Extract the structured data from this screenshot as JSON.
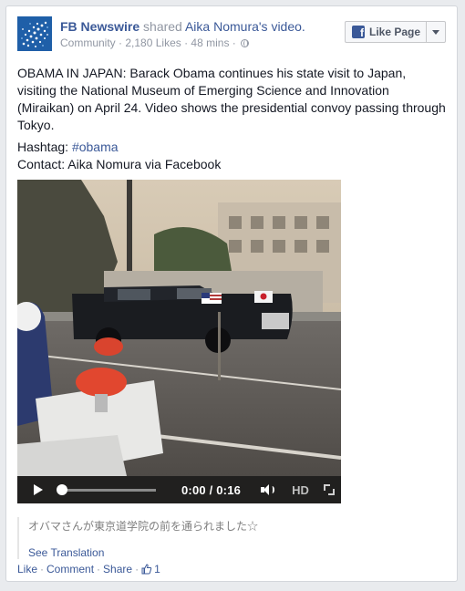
{
  "post": {
    "page_name": "FB Newswire",
    "shared_word": "shared",
    "shared_source": "Aika Nomura's video.",
    "category": "Community",
    "likes": "2,180 Likes",
    "time": "48 mins",
    "like_page_label": "Like Page",
    "body_text": "OBAMA IN JAPAN: Barack Obama continues his state visit to Japan, visiting the National Museum of Emerging Science and Innovation (Miraikan) on April 24. Video shows the presidential convoy passing through Tokyo.",
    "hashtag_label": "Hashtag:",
    "hashtag": "#obama",
    "contact": "Contact: Aika Nomura via Facebook"
  },
  "video": {
    "time_display": "0:00 / 0:16",
    "hd_label": "HD",
    "progress": 0.0
  },
  "quote": {
    "text": "オバマさんが東京道学院の前を通られました☆",
    "see_translation": "See Translation"
  },
  "actions": {
    "like": "Like",
    "comment": "Comment",
    "share": "Share",
    "like_count": "1"
  },
  "icons": {
    "play": "play-icon",
    "volume": "volume-icon",
    "fullscreen": "fullscreen-icon",
    "globe": "globe-icon",
    "thumbs_up": "thumbs-up-icon",
    "facebook": "facebook-icon"
  },
  "colors": {
    "link": "#3b5998",
    "muted": "#9197a3"
  }
}
